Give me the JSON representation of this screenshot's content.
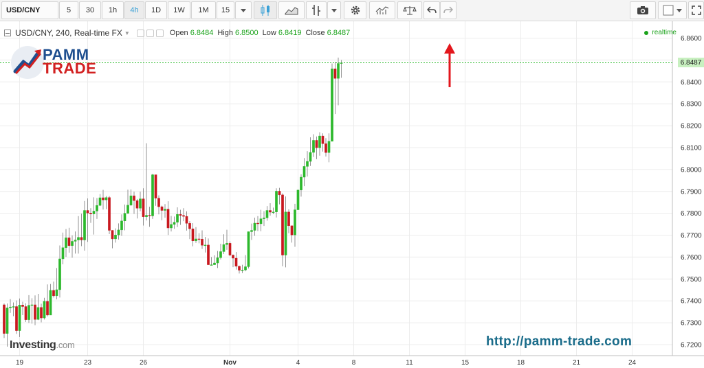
{
  "toolbar": {
    "symbol": "USD/CNY",
    "intervals": [
      "5",
      "30",
      "1h",
      "4h",
      "1D",
      "1W",
      "1M",
      "15"
    ],
    "active_interval": "4h"
  },
  "legend": {
    "symbol": "USD/CNY, 240, Real-time FX",
    "open_label": "Open",
    "open": "6.8484",
    "high_label": "High",
    "high": "6.8500",
    "low_label": "Low",
    "low": "6.8419",
    "close_label": "Close",
    "close": "6.8487"
  },
  "realtime_label": "realtime",
  "current_price": "6.8487",
  "logo": {
    "line1": "PAMM",
    "line2": "TRADE"
  },
  "watermark": {
    "brand": "Investing",
    "suffix": ".com"
  },
  "site_url": "http://pamm-trade.com",
  "colors": {
    "up": "#2db82d",
    "down": "#c9181f",
    "arrow": "#e3161c",
    "price_line": "#22b822"
  },
  "chart_data": {
    "type": "candlestick",
    "ylim": [
      6.715,
      6.8635
    ],
    "y_ticks": [
      "6.8600",
      "6.8500",
      "6.8400",
      "6.8300",
      "6.8200",
      "6.8100",
      "6.8000",
      "6.7900",
      "6.7800",
      "6.7700",
      "6.7600",
      "6.7500",
      "6.7400",
      "6.7300",
      "6.7200"
    ],
    "x_ticks": [
      {
        "label": "19",
        "at": 5
      },
      {
        "label": "23",
        "at": 27
      },
      {
        "label": "26",
        "at": 45
      },
      {
        "label": "Nov",
        "at": 73
      },
      {
        "label": "4",
        "at": 95
      },
      {
        "label": "8",
        "at": 113
      },
      {
        "label": "11",
        "at": 131
      },
      {
        "label": "15",
        "at": 149
      },
      {
        "label": "18",
        "at": 167
      },
      {
        "label": "21",
        "at": 185
      },
      {
        "label": "24",
        "at": 203
      }
    ],
    "candles": [
      [
        6.7382,
        6.7251,
        6.7388,
        6.723
      ],
      [
        6.7251,
        6.7368,
        6.7388,
        6.7191
      ],
      [
        6.7368,
        6.7372,
        6.7408,
        6.7345
      ],
      [
        6.7372,
        6.7374,
        6.7393,
        6.733
      ],
      [
        6.7374,
        6.7264,
        6.7402,
        6.7249
      ],
      [
        6.7264,
        6.7381,
        6.7411,
        6.7235
      ],
      [
        6.7381,
        6.7374,
        6.7396,
        6.7335
      ],
      [
        6.7374,
        6.7314,
        6.7389,
        6.7304
      ],
      [
        6.7314,
        6.738,
        6.7426,
        6.7299
      ],
      [
        6.738,
        6.7382,
        6.7412,
        6.7296
      ],
      [
        6.7382,
        6.7315,
        6.7425,
        6.7289
      ],
      [
        6.7315,
        6.737,
        6.7432,
        6.7312
      ],
      [
        6.737,
        6.7322,
        6.7387,
        6.7302
      ],
      [
        6.7322,
        6.7398,
        6.7414,
        6.7315
      ],
      [
        6.7398,
        6.7335,
        6.7475,
        6.7329
      ],
      [
        6.7335,
        6.7448,
        6.7477,
        6.7335
      ],
      [
        6.7448,
        6.7423,
        6.7488,
        6.7415
      ],
      [
        6.7423,
        6.7451,
        6.755,
        6.7407
      ],
      [
        6.7451,
        6.7592,
        6.7653,
        6.7415
      ],
      [
        6.7592,
        6.7643,
        6.7712,
        6.7567
      ],
      [
        6.7643,
        6.7688,
        6.7728,
        6.7601
      ],
      [
        6.7688,
        6.7652,
        6.7734,
        6.762
      ],
      [
        6.7652,
        6.7672,
        6.7699,
        6.7597
      ],
      [
        6.7672,
        6.7678,
        6.7717,
        6.7616
      ],
      [
        6.7678,
        6.769,
        6.7787,
        6.7616
      ],
      [
        6.769,
        6.7678,
        6.7798,
        6.765
      ],
      [
        6.7678,
        6.7813,
        6.7856,
        6.7629
      ],
      [
        6.7813,
        6.7801,
        6.7868,
        6.7669
      ],
      [
        6.7801,
        6.7797,
        6.7823,
        6.7756
      ],
      [
        6.7797,
        6.781,
        6.7873,
        6.7703
      ],
      [
        6.781,
        6.7836,
        6.787,
        6.7774
      ],
      [
        6.7836,
        6.7871,
        6.7888,
        6.7833
      ],
      [
        6.7871,
        6.7861,
        6.7907,
        6.7817
      ],
      [
        6.7861,
        6.7872,
        6.7879,
        6.7819
      ],
      [
        6.7872,
        6.7722,
        6.7879,
        6.7705
      ],
      [
        6.7722,
        6.7683,
        6.7723,
        6.764
      ],
      [
        6.7683,
        6.7701,
        6.7731,
        6.7666
      ],
      [
        6.7701,
        6.7724,
        6.7754,
        6.768
      ],
      [
        6.7724,
        6.7765,
        6.7795,
        6.7697
      ],
      [
        6.7765,
        6.78,
        6.784,
        6.7722
      ],
      [
        6.78,
        6.7837,
        6.7908,
        6.7797
      ],
      [
        6.7837,
        6.788,
        6.7909,
        6.7834
      ],
      [
        6.788,
        6.7858,
        6.7899,
        6.7797
      ],
      [
        6.7858,
        6.7823,
        6.7865,
        6.7776
      ],
      [
        6.7823,
        6.7866,
        6.7899,
        6.7809
      ],
      [
        6.7866,
        6.7784,
        6.7914,
        6.7744
      ],
      [
        6.7784,
        6.7791,
        6.812,
        6.7767
      ],
      [
        6.7791,
        6.7788,
        6.783,
        6.7738
      ],
      [
        6.7788,
        6.7976,
        6.798,
        6.7774
      ],
      [
        6.7976,
        6.7869,
        6.7976,
        6.7834
      ],
      [
        6.7869,
        6.783,
        6.7882,
        6.7795
      ],
      [
        6.783,
        6.7813,
        6.7835,
        6.7768
      ],
      [
        6.7813,
        6.7819,
        6.7842,
        6.778
      ],
      [
        6.7819,
        6.7733,
        6.7855,
        6.7701
      ],
      [
        6.7733,
        6.7749,
        6.7788,
        6.7717
      ],
      [
        6.7749,
        6.7759,
        6.7785,
        6.7729
      ],
      [
        6.7759,
        6.7795,
        6.7827,
        6.7737
      ],
      [
        6.7795,
        6.779,
        6.7816,
        6.7747
      ],
      [
        6.779,
        6.7786,
        6.7823,
        6.7764
      ],
      [
        6.7786,
        6.7754,
        6.7809,
        6.7721
      ],
      [
        6.7754,
        6.7729,
        6.7764,
        6.7682
      ],
      [
        6.7729,
        6.7674,
        6.7755,
        6.7649
      ],
      [
        6.7674,
        6.7683,
        6.7737,
        6.7665
      ],
      [
        6.7683,
        6.7682,
        6.7709,
        6.7663
      ],
      [
        6.7682,
        6.7654,
        6.7722,
        6.7637
      ],
      [
        6.7654,
        6.7655,
        6.7692,
        6.7621
      ],
      [
        6.7655,
        6.7565,
        6.7685,
        6.7565
      ],
      [
        6.7565,
        6.7565,
        6.76,
        6.7563
      ],
      [
        6.7565,
        6.7573,
        6.7608,
        6.7565
      ],
      [
        6.7573,
        6.7597,
        6.7628,
        6.755
      ],
      [
        6.7597,
        6.7625,
        6.7661,
        6.7589
      ],
      [
        6.7625,
        6.7657,
        6.7704,
        6.7614
      ],
      [
        6.7657,
        6.7663,
        6.7725,
        6.7633
      ],
      [
        6.7663,
        6.7609,
        6.7672,
        6.7604
      ],
      [
        6.7609,
        6.7595,
        6.7612,
        6.7554
      ],
      [
        6.7595,
        6.7558,
        6.7623,
        6.7543
      ],
      [
        6.7558,
        6.754,
        6.7561,
        6.7525
      ],
      [
        6.754,
        6.7541,
        6.7565,
        6.7527
      ],
      [
        6.7541,
        6.7556,
        6.7609,
        6.7535
      ],
      [
        6.7556,
        6.7716,
        6.7716,
        6.7548
      ],
      [
        6.7716,
        6.7722,
        6.7753,
        6.7678
      ],
      [
        6.7722,
        6.7755,
        6.778,
        6.7697
      ],
      [
        6.7755,
        6.7752,
        6.7787,
        6.7719
      ],
      [
        6.7752,
        6.7775,
        6.7816,
        6.7718
      ],
      [
        6.7775,
        6.7779,
        6.781,
        6.7742
      ],
      [
        6.7779,
        6.7813,
        6.7833,
        6.7766
      ],
      [
        6.7813,
        6.7805,
        6.7846,
        6.7789
      ],
      [
        6.7805,
        6.7806,
        6.7826,
        6.7796
      ],
      [
        6.7806,
        6.7901,
        6.7914,
        6.7781
      ],
      [
        6.7901,
        6.7884,
        6.7916,
        6.7841
      ],
      [
        6.7884,
        6.7609,
        6.7891,
        6.7558
      ],
      [
        6.7609,
        6.7806,
        6.7877,
        6.7553
      ],
      [
        6.7806,
        6.7743,
        6.7818,
        6.7709
      ],
      [
        6.7743,
        6.7701,
        6.7738,
        6.7666
      ],
      [
        6.7701,
        6.7816,
        6.7843,
        6.7647
      ],
      [
        6.7816,
        6.7906,
        6.7908,
        6.7816
      ],
      [
        6.7906,
        6.7965,
        6.7978,
        6.7876
      ],
      [
        6.7965,
        6.8014,
        6.8052,
        6.7924
      ],
      [
        6.8014,
        6.8037,
        6.8084,
        6.7968
      ],
      [
        6.8037,
        6.8078,
        6.8147,
        6.8016
      ],
      [
        6.8078,
        6.8133,
        6.8161,
        6.8057
      ],
      [
        6.8133,
        6.8099,
        6.8151,
        6.8047
      ],
      [
        6.8099,
        6.8153,
        6.817,
        6.8063
      ],
      [
        6.8153,
        6.8118,
        6.8165,
        6.8082
      ],
      [
        6.8118,
        6.8077,
        6.8143,
        6.8059
      ],
      [
        6.8077,
        6.8129,
        6.8165,
        6.8033
      ],
      [
        6.8129,
        6.846,
        6.8484,
        6.8129
      ],
      [
        6.846,
        6.8416,
        6.8491,
        6.8253
      ],
      [
        6.8416,
        6.8484,
        6.8511,
        6.8293
      ],
      [
        6.8484,
        6.8487,
        6.85,
        6.8419
      ]
    ]
  }
}
